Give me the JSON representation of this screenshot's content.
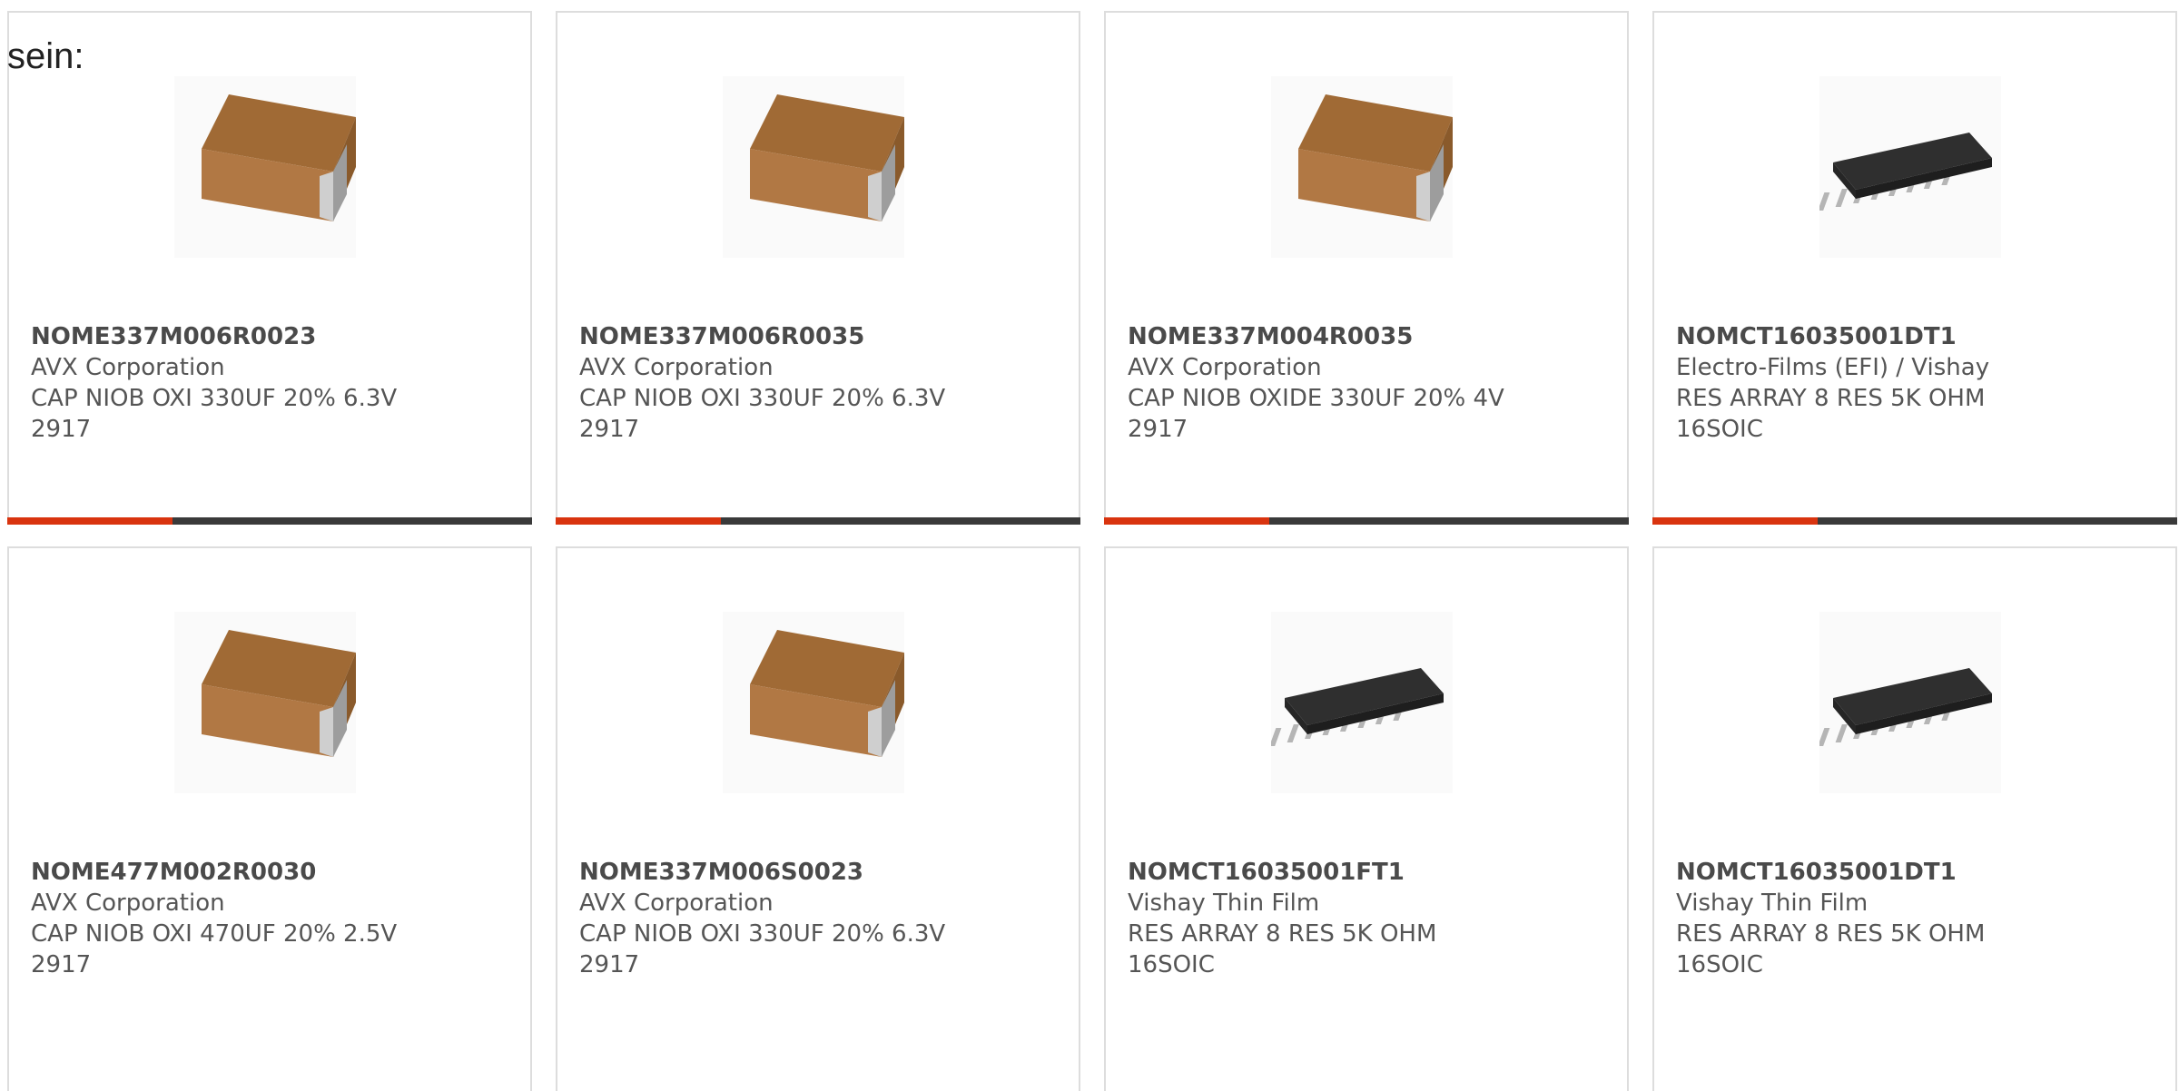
{
  "intro_text": "sein:",
  "colors": {
    "accent": "#d9340f",
    "bar": "#3a3a3a",
    "border": "#dddddd"
  },
  "products": [
    {
      "part": "NOME337M006R0023",
      "maker": "AVX Corporation",
      "desc": "CAP NIOB OXI 330UF 20% 6.3V 2917",
      "image": "tantalum-capacitor-icon"
    },
    {
      "part": "NOME337M006R0035",
      "maker": "AVX Corporation",
      "desc": "CAP NIOB OXI 330UF 20% 6.3V 2917",
      "image": "tantalum-capacitor-icon"
    },
    {
      "part": "NOME337M004R0035",
      "maker": "AVX Corporation",
      "desc": "CAP NIOB OXIDE 330UF 20% 4V 2917",
      "image": "tantalum-capacitor-icon"
    },
    {
      "part": "NOMCT16035001DT1",
      "maker": "Electro-Films (EFI) / Vishay",
      "desc": "RES ARRAY 8 RES 5K OHM 16SOIC",
      "image": "soic-chip-icon"
    },
    {
      "part": "NOME477M002R0030",
      "maker": "AVX Corporation",
      "desc": "CAP NIOB OXI 470UF 20% 2.5V 2917",
      "image": "tantalum-capacitor-icon"
    },
    {
      "part": "NOME337M006S0023",
      "maker": "AVX Corporation",
      "desc": "CAP NIOB OXI 330UF 20% 6.3V 2917",
      "image": "tantalum-capacitor-icon"
    },
    {
      "part": "NOMCT16035001FT1",
      "maker": "Vishay Thin Film",
      "desc": "RES ARRAY 8 RES 5K OHM 16SOIC",
      "image": "soic-chip-icon"
    },
    {
      "part": "NOMCT16035001DT1",
      "maker": "Vishay Thin Film",
      "desc": "RES ARRAY 8 RES 5K OHM 16SOIC",
      "image": "soic-chip-icon"
    }
  ]
}
